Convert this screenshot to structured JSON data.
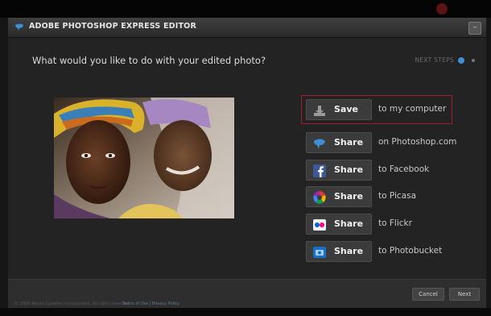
{
  "window": {
    "title": "ADOBE PHOTOSHOP EXPRESS EDITOR",
    "close_label": "–"
  },
  "prompt": {
    "question": "What would you like to do with your edited photo?",
    "next_steps": "NEXT STEPS"
  },
  "actions": [
    {
      "label": "Save",
      "target": "to my computer",
      "icon": "download-icon",
      "highlighted": true
    },
    {
      "label": "Share",
      "target": "on Photoshop.com",
      "icon": "photoshop-express-icon"
    },
    {
      "label": "Share",
      "target": "to Facebook",
      "icon": "facebook-icon"
    },
    {
      "label": "Share",
      "target": "to Picasa",
      "icon": "picasa-icon"
    },
    {
      "label": "Share",
      "target": "to Flickr",
      "icon": "flickr-icon"
    },
    {
      "label": "Share",
      "target": "to Photobucket",
      "icon": "photobucket-icon"
    }
  ],
  "footer": {
    "cancel_label": "Cancel",
    "next_label": "Next",
    "legal": "© 2008 Adobe Systems Incorporated. All rights reserved.",
    "terms": "Terms of Use | Privacy Policy"
  },
  "colors": {
    "accent_blue": "#3d8fd6",
    "highlight_red": "#a11d2d"
  }
}
